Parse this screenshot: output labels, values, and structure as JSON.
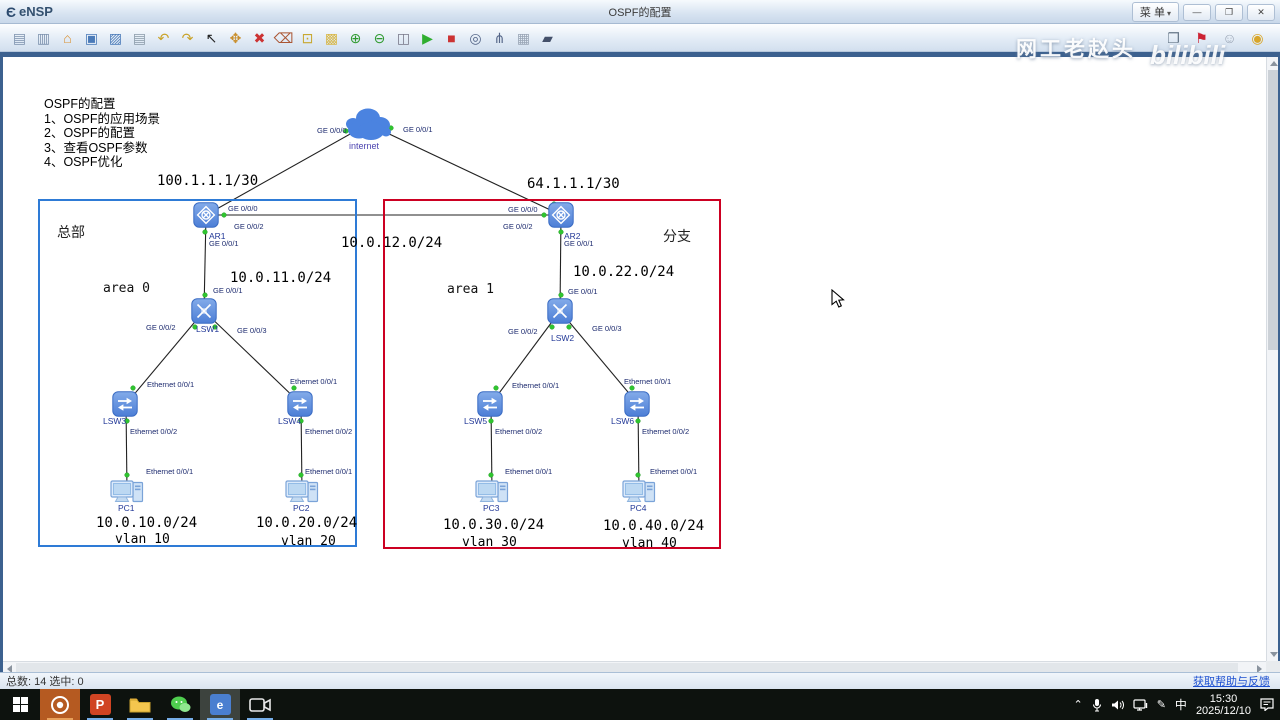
{
  "window": {
    "logo_text": "eNSP",
    "logo_mark": "Є",
    "title": "OSPF的配置",
    "menu_label": "菜 单",
    "minimize_glyph": "—",
    "restore_glyph": "❐",
    "close_glyph": "✕"
  },
  "watermark": {
    "name": "网工老赵头",
    "brand": "bilibili"
  },
  "toolbar": {
    "left_icons": [
      {
        "name": "new-topology",
        "glyph": "▤"
      },
      {
        "name": "new-test-paper",
        "glyph": "▥"
      },
      {
        "name": "open",
        "glyph": "⌂"
      },
      {
        "name": "save",
        "glyph": "▣"
      },
      {
        "name": "save-as",
        "glyph": "▨"
      },
      {
        "name": "print",
        "glyph": "▤"
      },
      {
        "name": "undo",
        "glyph": "↶"
      },
      {
        "name": "redo",
        "glyph": "↷"
      },
      {
        "name": "select",
        "glyph": "↖"
      },
      {
        "name": "pan",
        "glyph": "✥"
      },
      {
        "name": "delete",
        "glyph": "✖"
      },
      {
        "name": "delete-connections",
        "glyph": "⌫"
      },
      {
        "name": "add-note",
        "glyph": "⊡"
      },
      {
        "name": "palette",
        "glyph": "▩"
      },
      {
        "name": "zoom-in",
        "glyph": "⊕"
      },
      {
        "name": "zoom-out",
        "glyph": "⊖"
      },
      {
        "name": "zoom-reset",
        "glyph": "◫"
      },
      {
        "name": "start-devices",
        "glyph": "▶"
      },
      {
        "name": "stop-devices",
        "glyph": "■"
      },
      {
        "name": "packet-capture",
        "glyph": "◎"
      },
      {
        "name": "topology-data",
        "glyph": "⋔"
      },
      {
        "name": "grid",
        "glyph": "▦"
      },
      {
        "name": "console-display",
        "glyph": "▰"
      }
    ],
    "right_icons": [
      {
        "name": "console-panel",
        "glyph": "❐"
      },
      {
        "name": "pin",
        "glyph": "⚑"
      },
      {
        "name": "user",
        "glyph": "☺"
      },
      {
        "name": "about",
        "glyph": "◉"
      }
    ]
  },
  "canvas": {
    "notes": [
      "OSPF的配置",
      "1、OSPF的应用场景",
      "2、OSPF的配置",
      "3、查看OSPF参数",
      "4、OSPF优化"
    ],
    "cloud_label": "internet",
    "zones": {
      "hq": {
        "name": "总部",
        "area": "area 0",
        "border_color": "#2e7bd6"
      },
      "branch": {
        "name": "分支",
        "area": "area 1",
        "border_color": "#cc0022"
      }
    },
    "devices": {
      "ar1": "AR1",
      "ar2": "AR2",
      "lsw1": "LSW1",
      "lsw2": "LSW2",
      "lsw3": "LSW3",
      "lsw4": "LSW4",
      "lsw5": "LSW5",
      "lsw6": "LSW6",
      "pc1": "PC1",
      "pc2": "PC2",
      "pc3": "PC3",
      "pc4": "PC4"
    },
    "networks": {
      "wan_hq": "100.1.1.1/30",
      "wan_branch": "64.1.1.1/30",
      "inter_router": "10.0.12.0/24",
      "hq_lan": "10.0.11.0/24",
      "branch_lan": "10.0.22.0/24",
      "vlan10_net": "10.0.10.0/24",
      "vlan20_net": "10.0.20.0/24",
      "vlan30_net": "10.0.30.0/24",
      "vlan40_net": "10.0.40.0/24"
    },
    "vlans": [
      "vlan 10",
      "vlan 20",
      "vlan 30",
      "vlan 40"
    ],
    "if_labels": [
      "GE 0/0/0",
      "GE 0/0/1",
      "GE 0/0/0",
      "GE 0/0/2",
      "GE 0/0/1",
      "GE 0/0/0",
      "GE 0/0/2",
      "GE 0/0/1",
      "GE 0/0/1",
      "GE 0/0/2",
      "GE 0/0/3",
      "GE 0/0/1",
      "GE 0/0/2",
      "GE 0/0/3",
      "Ethernet 0/0/1",
      "Ethernet 0/0/2",
      "Ethernet 0/0/1",
      "Ethernet 0/0/2",
      "Ethernet 0/0/1",
      "Ethernet 0/0/2",
      "Ethernet 0/0/1",
      "Ethernet 0/0/2",
      "Ethernet 0/0/1",
      "Ethernet 0/0/1",
      "Ethernet 0/0/1",
      "Ethernet 0/0/1"
    ],
    "colors": {
      "device_fill": "#5b8bdc",
      "link_up_dot": "#2fc52f",
      "link_line": "#222222"
    }
  },
  "statusbar": {
    "summary": "总数: 14 选中: 0",
    "help_link": "获取帮助与反馈"
  },
  "taskbar": {
    "powerpoint_glyph": "P",
    "ensp_glyph": "e",
    "ime": "中",
    "time": "15:30",
    "date": "2025/12/10"
  }
}
